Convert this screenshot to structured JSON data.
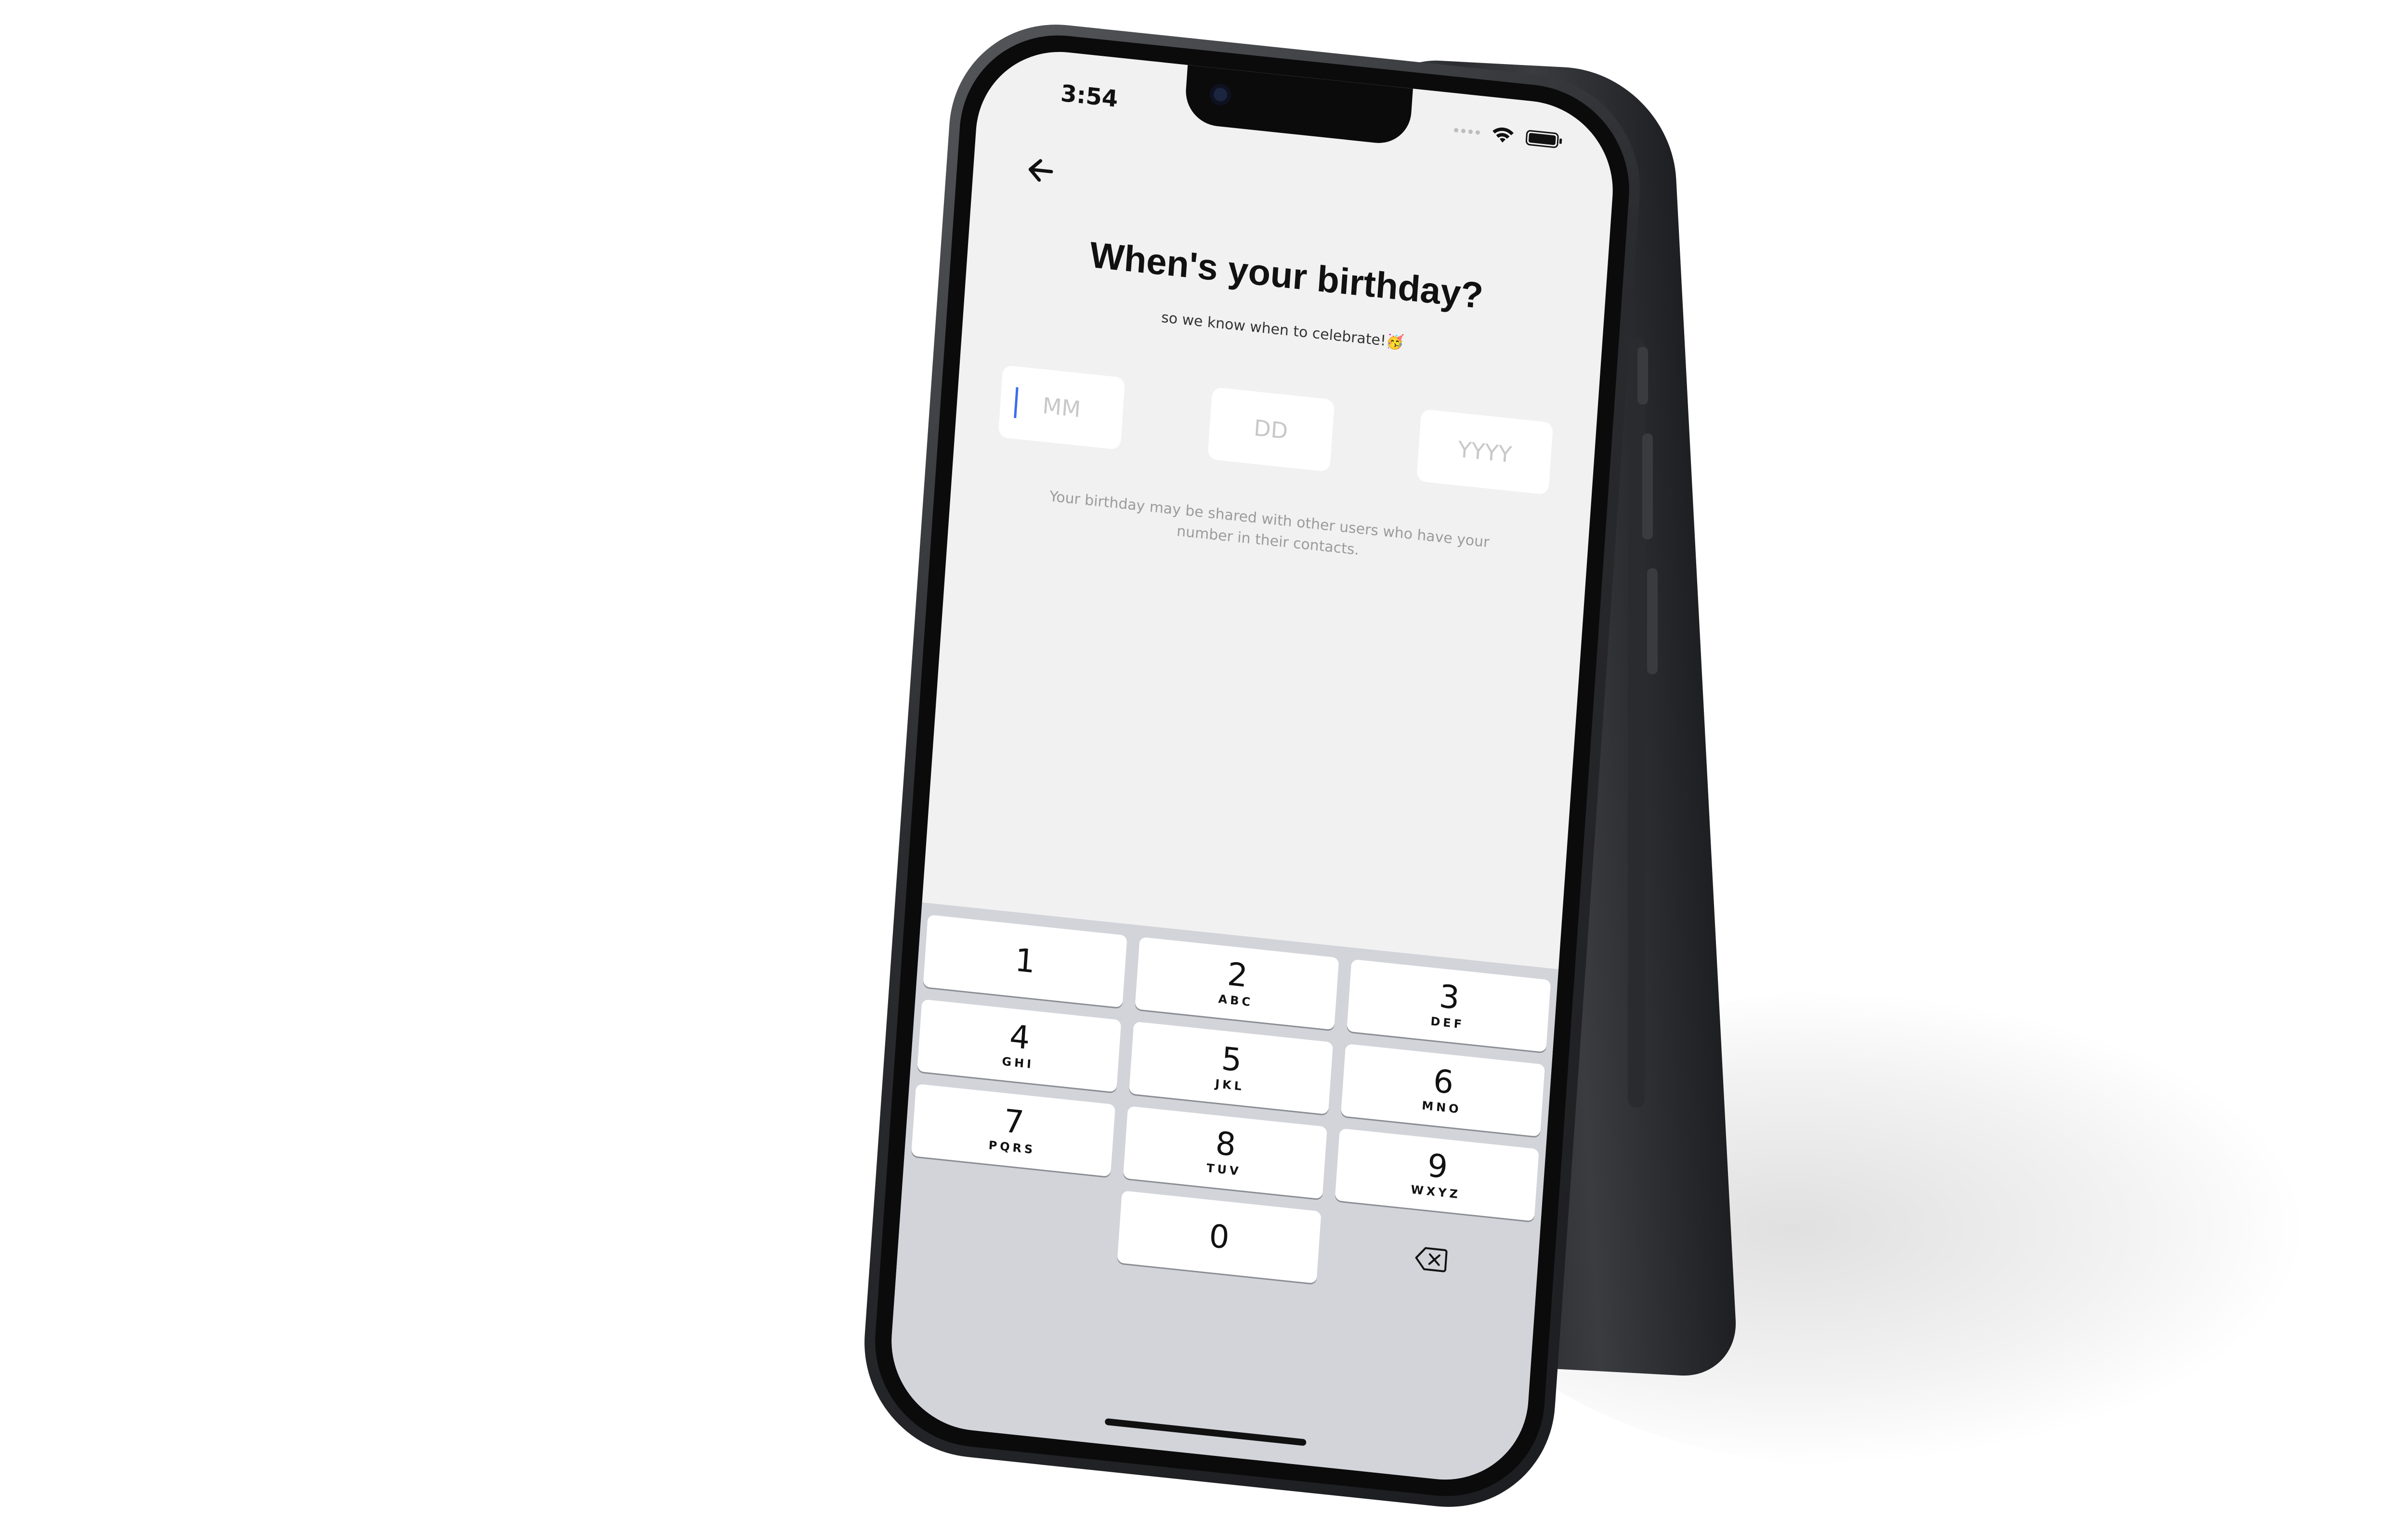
{
  "status_bar": {
    "time": "3:54"
  },
  "header": {
    "back_icon": "arrow-left-icon"
  },
  "main": {
    "title": "When's your birthday?",
    "subtitle": "so we know when to celebrate!🥳",
    "fields": {
      "month": {
        "placeholder": "MM",
        "value": ""
      },
      "day": {
        "placeholder": "DD",
        "value": ""
      },
      "year": {
        "placeholder": "YYYY",
        "value": ""
      }
    },
    "notice": "Your birthday may be shared with other users who have your number in their contacts."
  },
  "keyboard": {
    "keys": [
      {
        "num": "1",
        "letters": ""
      },
      {
        "num": "2",
        "letters": "ABC"
      },
      {
        "num": "3",
        "letters": "DEF"
      },
      {
        "num": "4",
        "letters": "GHI"
      },
      {
        "num": "5",
        "letters": "JKL"
      },
      {
        "num": "6",
        "letters": "MNO"
      },
      {
        "num": "7",
        "letters": "PQRS"
      },
      {
        "num": "8",
        "letters": "TUV"
      },
      {
        "num": "9",
        "letters": "WXYZ"
      },
      {
        "num": "0",
        "letters": ""
      }
    ],
    "delete_icon": "backspace-icon"
  }
}
